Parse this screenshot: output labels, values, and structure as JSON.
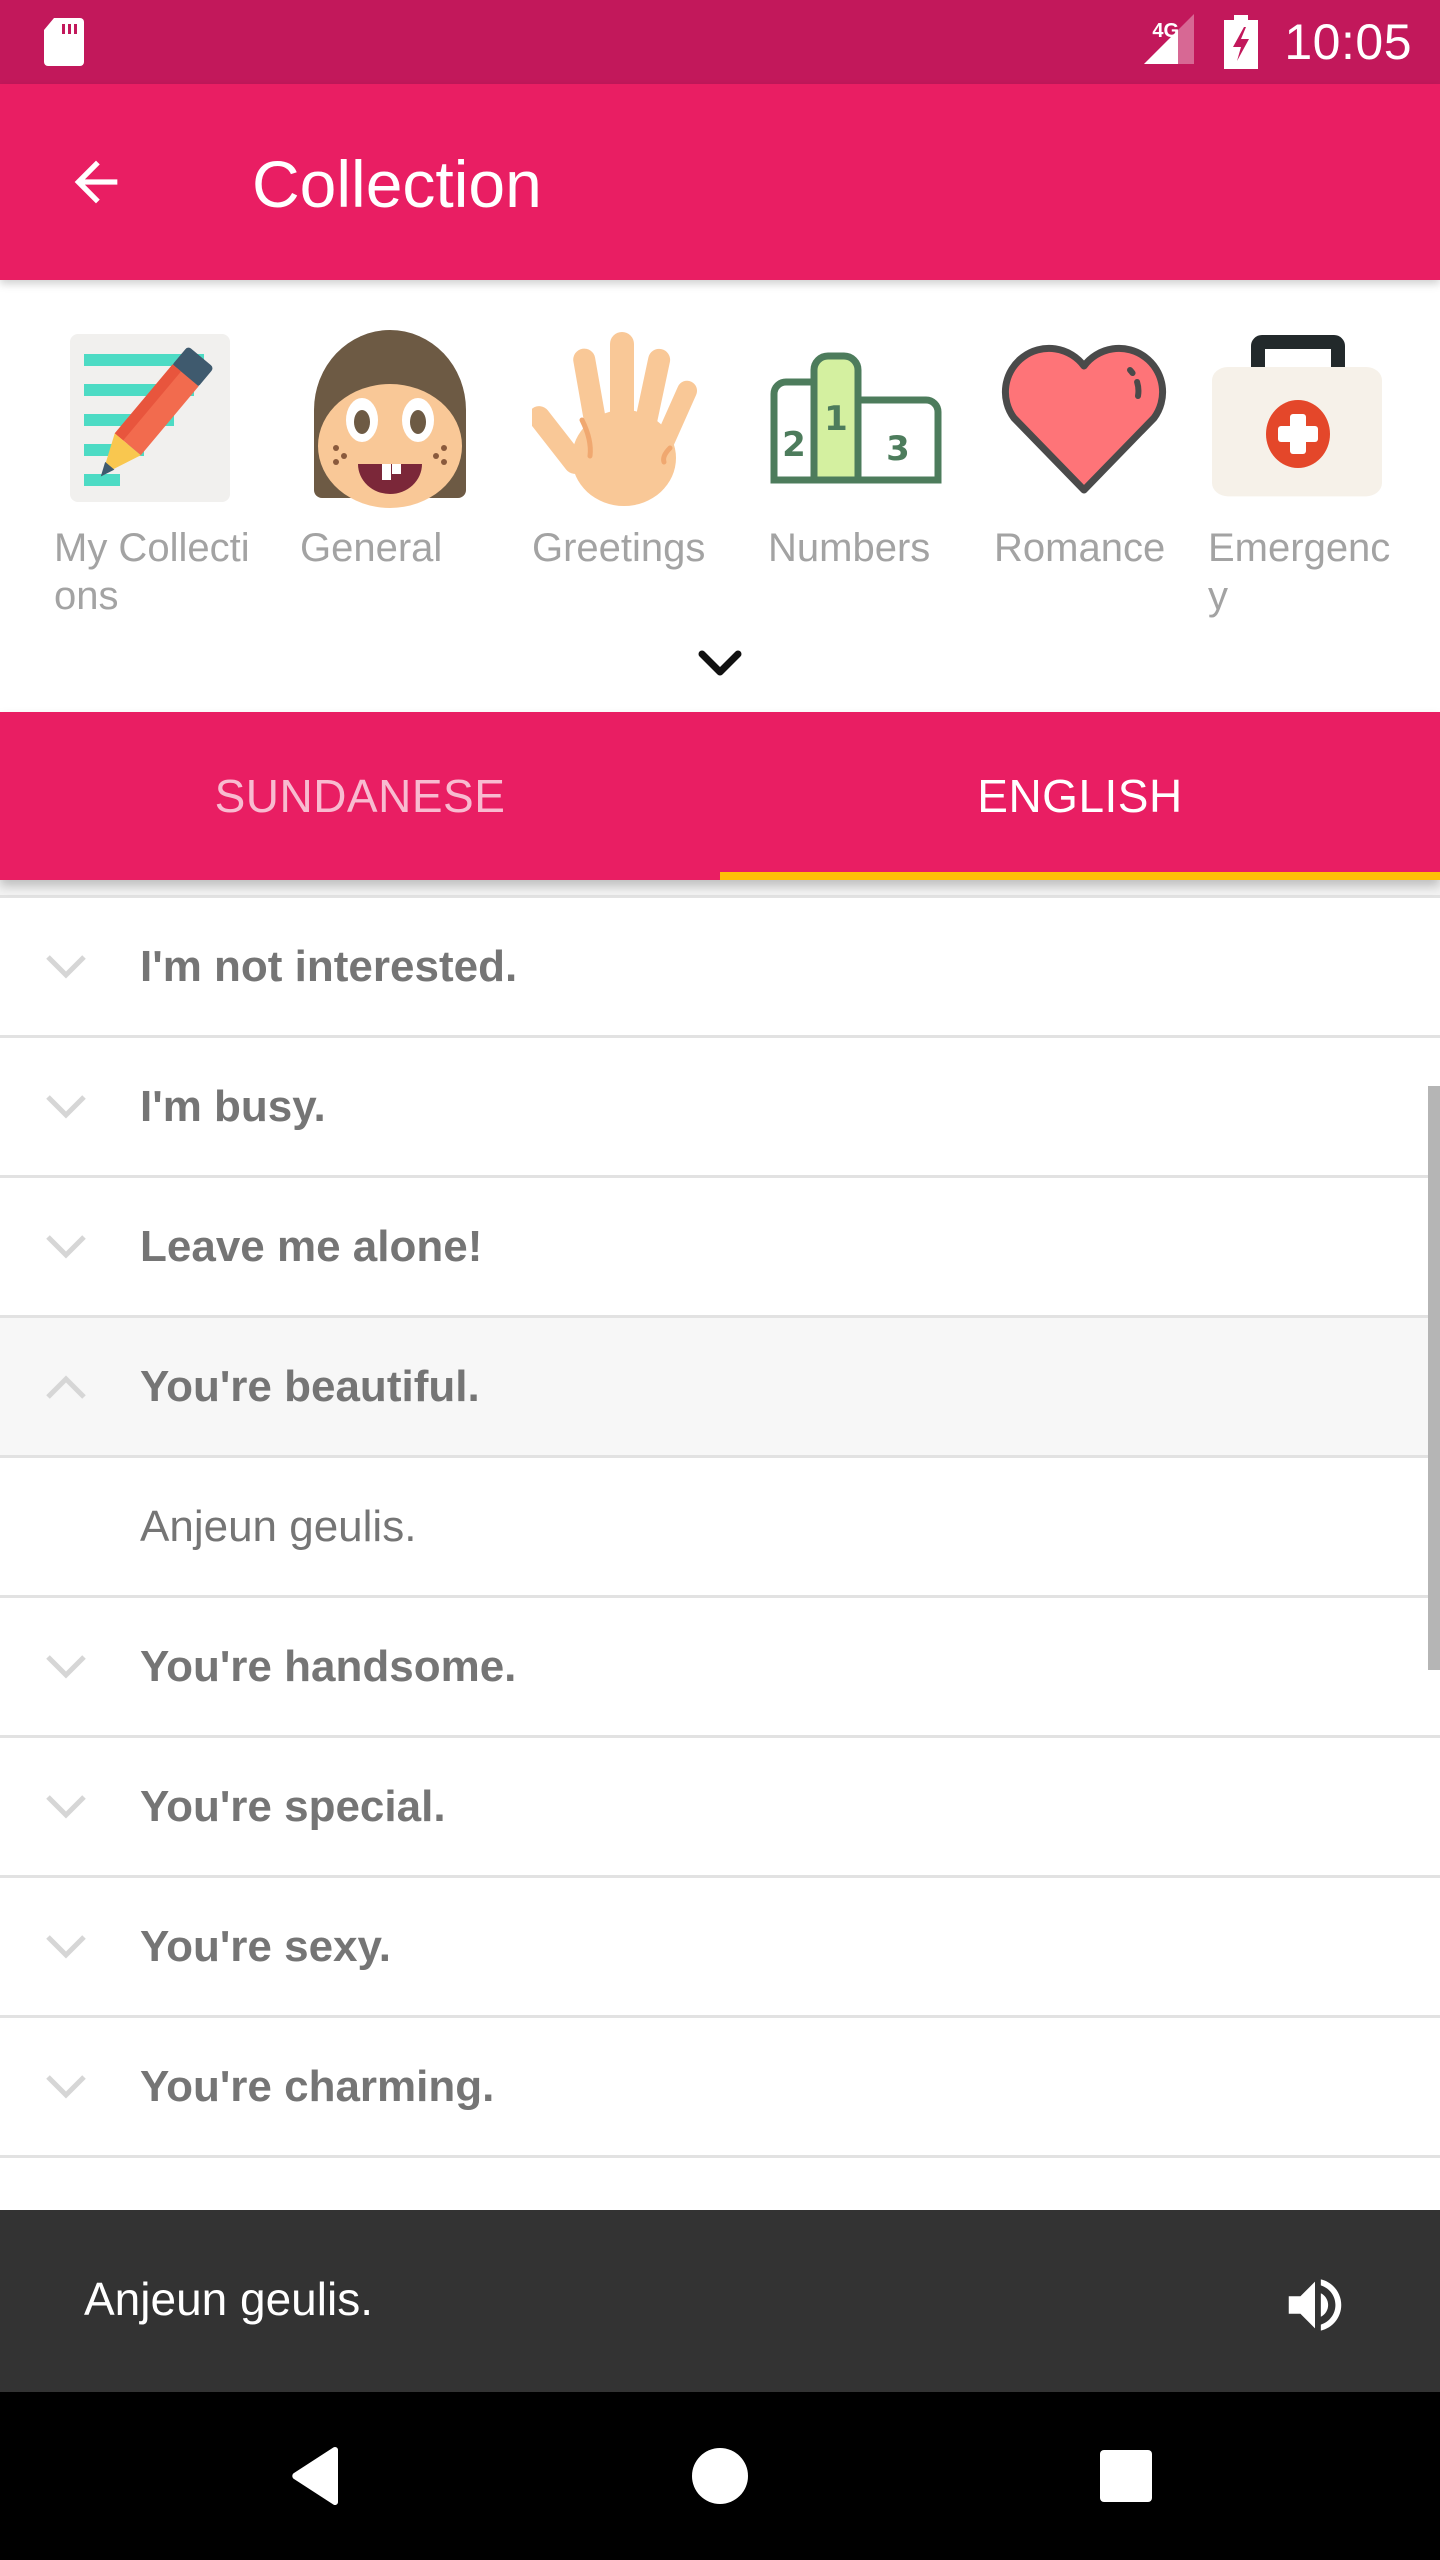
{
  "status_bar": {
    "network": "4G",
    "time": "10:05"
  },
  "app_bar": {
    "title": "Collection",
    "back_icon": "arrow-back-icon"
  },
  "categories": {
    "items": [
      {
        "label": "My Collections",
        "icon": "notepad-pencil-icon"
      },
      {
        "label": "General",
        "icon": "smiling-face-icon"
      },
      {
        "label": "Greetings",
        "icon": "waving-hand-icon"
      },
      {
        "label": "Numbers",
        "icon": "podium-123-icon"
      },
      {
        "label": "Romance",
        "icon": "heart-icon"
      },
      {
        "label": "Emergency",
        "icon": "first-aid-kit-icon"
      }
    ],
    "expand_icon": "chevron-down-icon"
  },
  "tabs": {
    "items": [
      {
        "label": "SUNDANESE",
        "active": false
      },
      {
        "label": "ENGLISH",
        "active": true
      }
    ],
    "indicator_color": "#FFC107"
  },
  "phrases": {
    "items": [
      {
        "text": "I'm not interested.",
        "expanded": false
      },
      {
        "text": "I'm busy.",
        "expanded": false
      },
      {
        "text": "Leave me alone!",
        "expanded": false
      },
      {
        "text": "You're beautiful.",
        "expanded": true,
        "translation": "Anjeun geulis."
      },
      {
        "text": "You're handsome.",
        "expanded": false
      },
      {
        "text": "You're special.",
        "expanded": false
      },
      {
        "text": "You're sexy.",
        "expanded": false
      },
      {
        "text": "You're charming.",
        "expanded": false
      }
    ]
  },
  "player": {
    "text": "Anjeun geulis.",
    "speaker_icon": "speaker-volume-icon"
  },
  "nav_bar": {
    "back": "nav-back-icon",
    "home": "nav-home-icon",
    "recents": "nav-recents-icon"
  },
  "colors": {
    "status_bar": "#C2185B",
    "primary": "#E91E63",
    "accent": "#FFC107",
    "player_bg": "#333333"
  }
}
